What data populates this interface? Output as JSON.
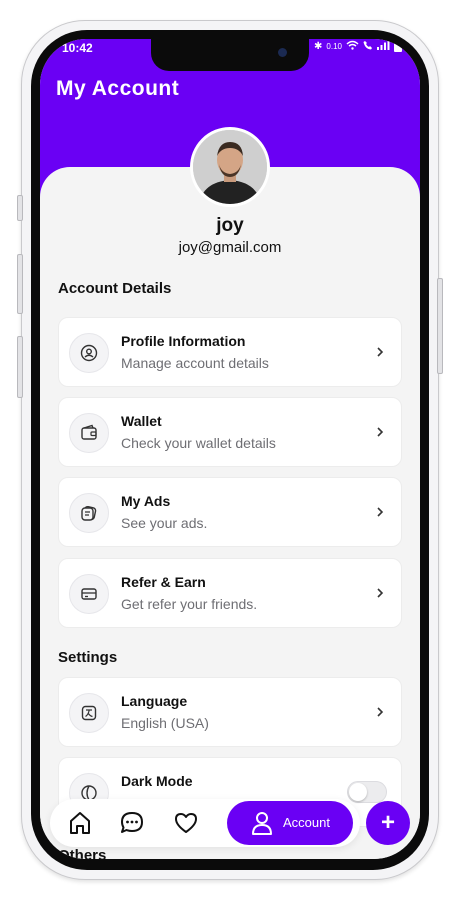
{
  "status_bar": {
    "time": "10:42",
    "net_speed": "0.10"
  },
  "header": {
    "title": "My Account"
  },
  "profile": {
    "name": "joy",
    "email": "joy@gmail.com"
  },
  "sections": {
    "account_details": "Account Details",
    "settings": "Settings",
    "others": "Others"
  },
  "account_items": [
    {
      "label": "Profile Information",
      "sub": "Manage account details",
      "icon": "user-circle-icon"
    },
    {
      "label": "Wallet",
      "sub": "Check your wallet details",
      "icon": "wallet-icon"
    },
    {
      "label": "My Ads",
      "sub": "See your ads.",
      "icon": "ads-icon"
    },
    {
      "label": "Refer & Earn",
      "sub": "Get refer your friends.",
      "icon": "card-icon"
    }
  ],
  "settings_items": [
    {
      "label": "Language",
      "sub": "English (USA)",
      "icon": "translate-icon"
    },
    {
      "label": "Dark Mode",
      "icon": "moon-icon",
      "toggle_on": false
    }
  ],
  "nav": {
    "account_label": "Account",
    "fab_label": "+"
  },
  "colors": {
    "brand": "#6a00f4",
    "background": "#f4f4f4"
  }
}
